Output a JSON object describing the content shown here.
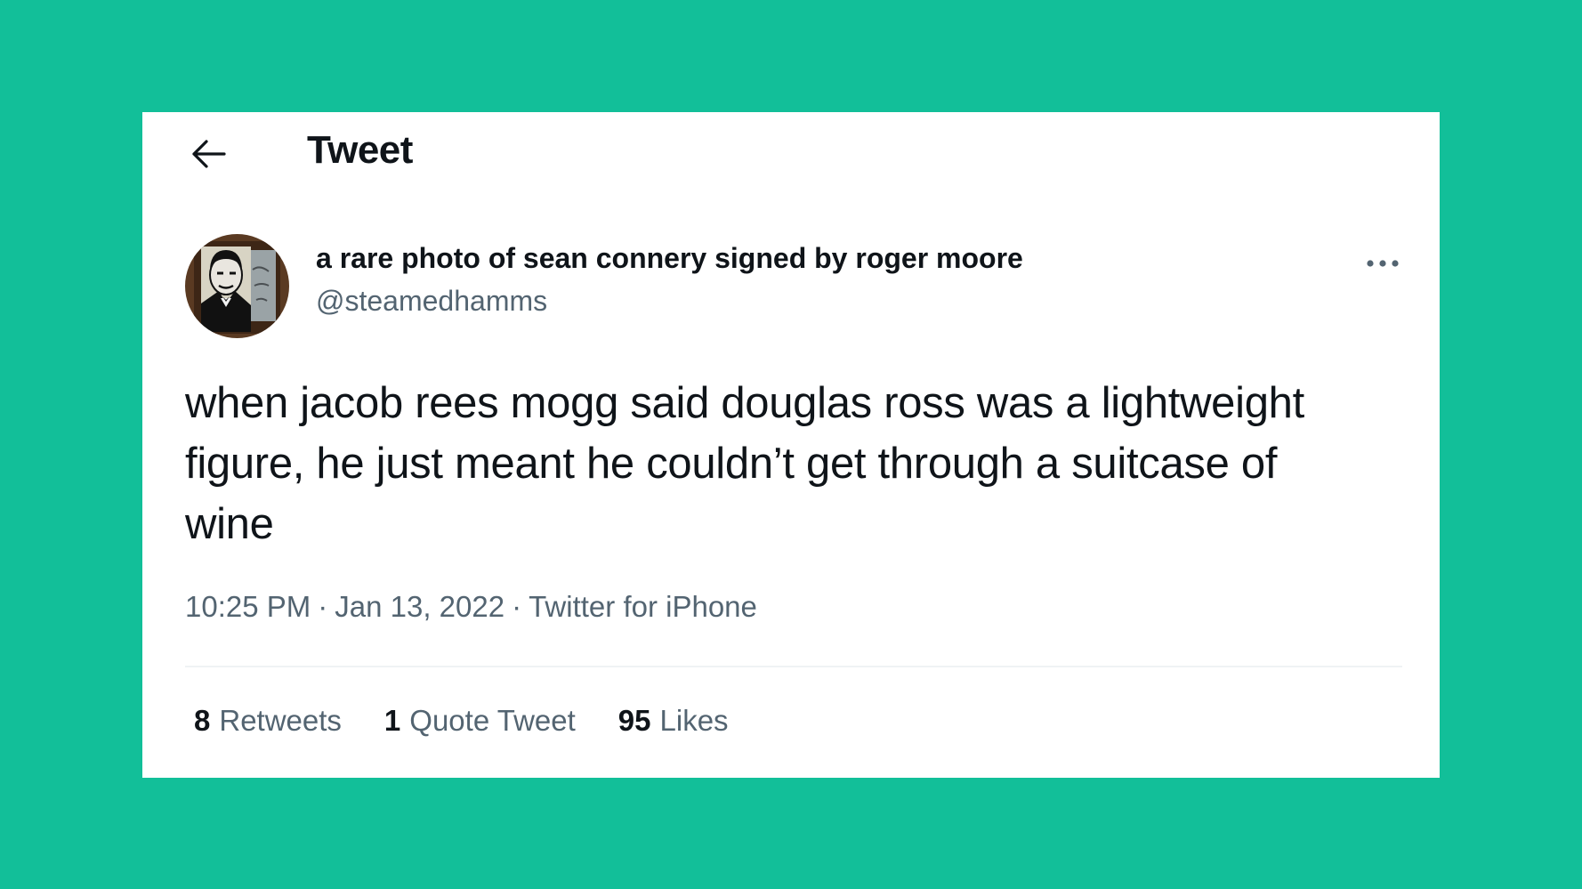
{
  "header": {
    "title": "Tweet",
    "back_icon": "arrow-left-icon"
  },
  "author": {
    "display_name": "a rare photo of sean connery signed by roger moore",
    "handle": "@steamedhamms",
    "avatar": "avatar-image"
  },
  "more_icon": "more-horizontal-icon",
  "tweet": {
    "text": "when jacob rees mogg said douglas ross was a lightweight figure, he just meant he couldn’t get through a suitcase of wine"
  },
  "meta": {
    "time": "10:25 PM",
    "date": "Jan 13, 2022",
    "source": "Twitter for iPhone",
    "separator": "·"
  },
  "stats": {
    "retweets_count": "8",
    "retweets_label": "Retweets",
    "quotes_count": "1",
    "quotes_label": "Quote Tweet",
    "likes_count": "95",
    "likes_label": "Likes"
  },
  "colors": {
    "background": "#12bf99",
    "card": "#ffffff",
    "text_primary": "#0f1419",
    "text_secondary": "#536471",
    "divider": "#eff3f4"
  }
}
